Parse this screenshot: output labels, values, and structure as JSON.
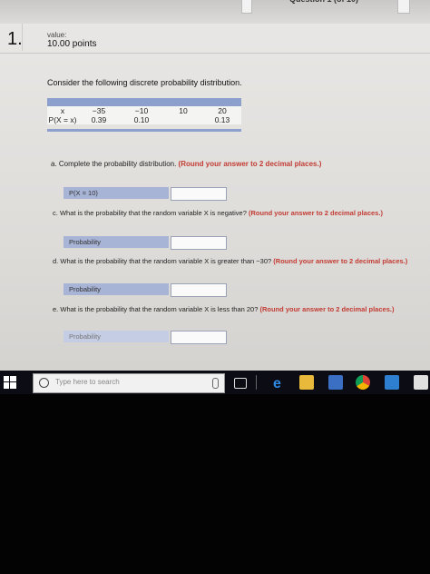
{
  "header": {
    "section_badge": "Question 1 (of 10)"
  },
  "question": {
    "number": "1.",
    "value_label": "value:",
    "points": "10.00 points",
    "prompt": "Consider the following discrete probability distribution."
  },
  "distribution": {
    "row_x": [
      "x",
      "−35",
      "−10",
      "10",
      "20"
    ],
    "row_p": [
      "P(X = x)",
      "0.39",
      "0.10",
      "",
      "0.13"
    ]
  },
  "parts": {
    "a": {
      "letter": "a.",
      "text": "Complete the probability distribution.",
      "note": "(Round your answer to 2 decimal places.)",
      "label": "P(X = 10)",
      "value": ""
    },
    "c": {
      "letter": "c.",
      "text": "What is the probability that the random variable X is negative?",
      "note": "(Round your answer to 2 decimal places.)",
      "label": "Probability",
      "value": ""
    },
    "d": {
      "letter": "d.",
      "text": "What is the probability that the random variable X is greater than −30?",
      "note": "(Round your answer to 2 decimal places.)",
      "label": "Probability",
      "value": ""
    },
    "e": {
      "letter": "e.",
      "text": "What is the probability that the random variable X is less than 20?",
      "note": "(Round your answer to 2 decimal places.)",
      "label": "Probability",
      "value": ""
    }
  },
  "taskbar": {
    "search_placeholder": "Type here to search",
    "icons": [
      "windows-icon",
      "search-icon",
      "microphone-icon",
      "task-view-icon",
      "edge-icon",
      "file-explorer-icon",
      "store-icon",
      "chrome-icon",
      "mail-icon",
      "app-icon"
    ]
  }
}
